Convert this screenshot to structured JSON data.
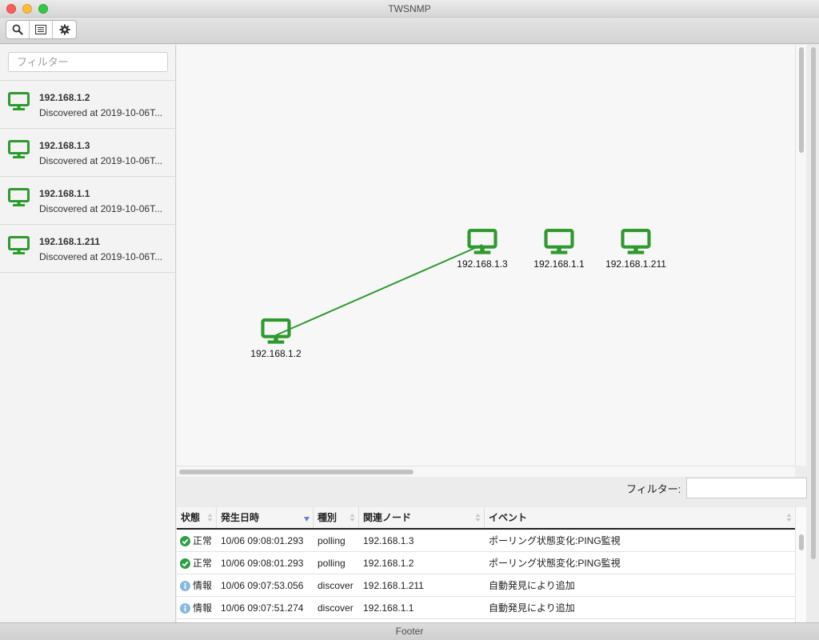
{
  "window": {
    "title": "TWSNMP"
  },
  "toolbar": {
    "icons": [
      "search-icon",
      "list-icon",
      "gear-icon"
    ]
  },
  "sidebar": {
    "filter_placeholder": "フィルター",
    "items": [
      {
        "ip": "192.168.1.2",
        "desc": "Discovered at 2019-10-06T..."
      },
      {
        "ip": "192.168.1.3",
        "desc": "Discovered at 2019-10-06T..."
      },
      {
        "ip": "192.168.1.1",
        "desc": "Discovered at 2019-10-06T..."
      },
      {
        "ip": "192.168.1.211",
        "desc": "Discovered at 2019-10-06T..."
      }
    ]
  },
  "map": {
    "node_color": "#2e9a2e",
    "nodes": [
      {
        "label": "192.168.1.2"
      },
      {
        "label": "192.168.1.3"
      },
      {
        "label": "192.168.1.1"
      },
      {
        "label": "192.168.1.211"
      }
    ],
    "link": {
      "from": "192.168.1.2",
      "to": "192.168.1.3"
    }
  },
  "log": {
    "filter_label": "フィルター:",
    "filter_value": "",
    "columns": [
      "状態",
      "発生日時",
      "種別",
      "関連ノード",
      "イベント"
    ],
    "sorted_column": "発生日時",
    "rows": [
      {
        "status": "正常",
        "status_icon": "check-circle-icon",
        "time": "10/06 09:08:01.293",
        "type": "polling",
        "node": "192.168.1.3",
        "event": "ポーリング状態変化:PING監視"
      },
      {
        "status": "正常",
        "status_icon": "check-circle-icon",
        "time": "10/06 09:08:01.293",
        "type": "polling",
        "node": "192.168.1.2",
        "event": "ポーリング状態変化:PING監視"
      },
      {
        "status": "情報",
        "status_icon": "info-circle-icon",
        "time": "10/06 09:07:53.056",
        "type": "discover",
        "node": "192.168.1.211",
        "event": "自動発見により追加"
      },
      {
        "status": "情報",
        "status_icon": "info-circle-icon",
        "time": "10/06 09:07:51.274",
        "type": "discover",
        "node": "192.168.1.1",
        "event": "自動発見により追加"
      }
    ]
  },
  "footer": {
    "text": "Footer"
  },
  "colors": {
    "ok": "#2ea043",
    "info": "#8ab8e0",
    "accent": "#2e9a2e"
  }
}
